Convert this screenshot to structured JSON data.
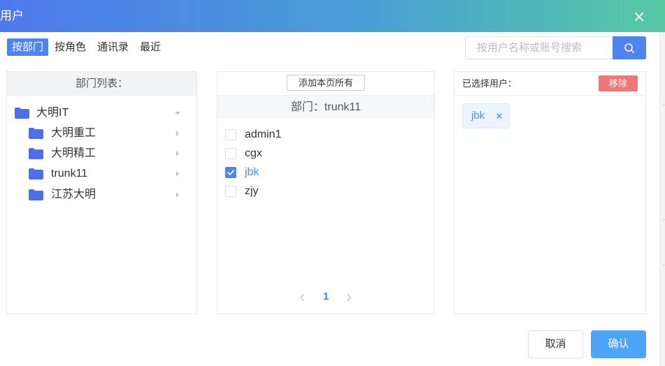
{
  "dialog": {
    "title": "用户",
    "close_icon": "close-icon"
  },
  "tabs": [
    {
      "label": "按部门",
      "active": true
    },
    {
      "label": "按角色",
      "active": false
    },
    {
      "label": "通讯录",
      "active": false
    },
    {
      "label": "最近",
      "active": false
    }
  ],
  "search": {
    "placeholder": "按用户名称或账号搜索",
    "value": "",
    "icon": "search-icon"
  },
  "dept_panel": {
    "title": "部门列表：",
    "tree": [
      {
        "label": "大明IT",
        "level": 0,
        "expanded": true
      },
      {
        "label": "大明重工",
        "level": 1,
        "expanded": false
      },
      {
        "label": "大明精工",
        "level": 1,
        "expanded": false
      },
      {
        "label": "trunk11",
        "level": 1,
        "expanded": false
      },
      {
        "label": "江苏大明",
        "level": 1,
        "expanded": false
      }
    ]
  },
  "user_panel": {
    "add_all_label": "添加本页所有",
    "dept_label": "部门：trunk11",
    "users": [
      {
        "name": "admin1",
        "checked": false
      },
      {
        "name": "cgx",
        "checked": false
      },
      {
        "name": "jbk",
        "checked": true
      },
      {
        "name": "zjy",
        "checked": false
      }
    ],
    "pagination": {
      "prev": "‹",
      "current": "1",
      "next": "›"
    }
  },
  "selected_panel": {
    "title": "已选择用户：",
    "remove_label": "移除",
    "selected": [
      {
        "name": "jbk"
      }
    ]
  },
  "footer": {
    "cancel_label": "取消",
    "confirm_label": "确认"
  },
  "colors": {
    "primary": "#4f83ee",
    "confirm": "#4ea4f5",
    "danger": "#f07777",
    "header_start": "#4e78ec",
    "header_end": "#56c9a3"
  }
}
